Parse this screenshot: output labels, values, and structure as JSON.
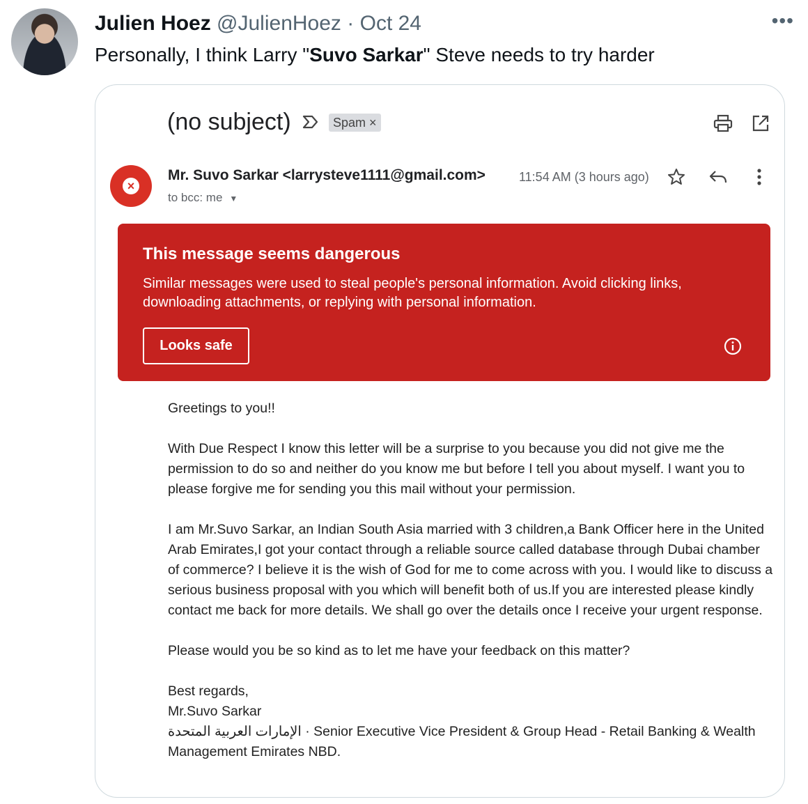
{
  "tweet": {
    "author_name": "Julien Hoez",
    "author_handle": "@JulienHoez",
    "separator": "·",
    "date": "Oct 24",
    "text_before": "Personally, I think Larry \"",
    "text_bold": "Suvo Sarkar",
    "text_after": "\" Steve needs to try harder",
    "more_label": "•••"
  },
  "email": {
    "subject": "(no subject)",
    "label_chip": "Spam ×",
    "sender": "Mr. Suvo Sarkar <larrysteve1111@gmail.com>",
    "recipient": "to bcc: me",
    "timestamp": "11:54 AM (3 hours ago)",
    "avatar_symbol": "×",
    "warning": {
      "title": "This message seems dangerous",
      "text": "Similar messages were used to steal people's personal information. Avoid clicking links, downloading attachments, or replying with personal information.",
      "button": "Looks safe"
    },
    "body": {
      "greeting": "Greetings to you!!",
      "p1": "With Due Respect I know this letter will be a surprise to you because you did not give me the permission to do so and neither do you know me but before I tell you about myself. I want you to please forgive me for sending you this mail without your permission.",
      "p2": "I am Mr.Suvo Sarkar, an Indian South Asia  married with 3 children,a Bank Officer here in the United Arab Emirates,I got your contact through a reliable source called database through Dubai chamber of commerce? I believe it is the wish of God for me to come across with you. I would like to discuss a serious business proposal with you which will benefit both of us.If you are interested please kindly contact me back for more details. We shall go over the details once I receive your urgent response.",
      "p3": "Please would you be so kind as to let me have your feedback on this matter?",
      "signoff": "Best regards,",
      "signature_name": "Mr.Suvo Sarkar",
      "signature_title": "الإمارات العربية المتحدة · Senior Executive Vice President & Group Head - Retail Banking & Wealth Management Emirates NBD."
    }
  },
  "colors": {
    "danger": "#c5221f",
    "avatar_red": "#d93025",
    "muted": "#536471"
  }
}
